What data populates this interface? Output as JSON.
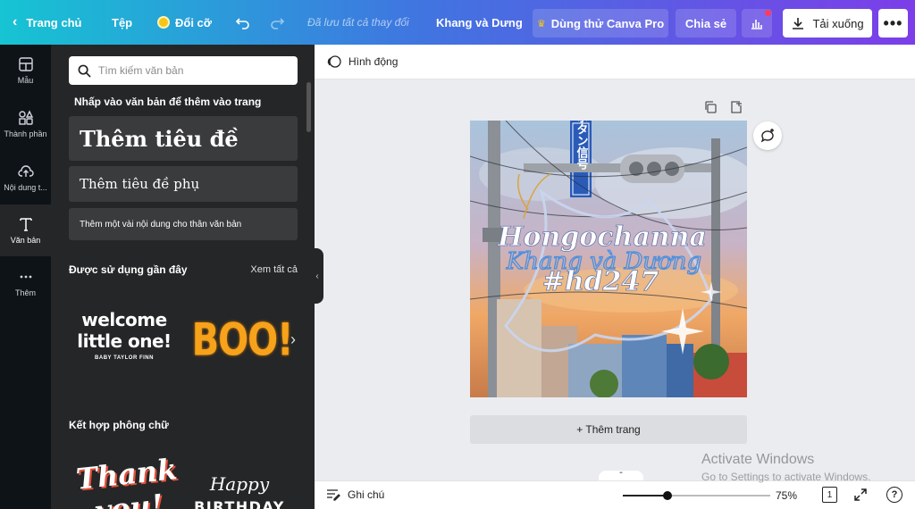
{
  "topbar": {
    "home": "Trang chủ",
    "file": "Tệp",
    "resize": "Đổi cỡ",
    "saved_status": "Đã lưu tất cả thay đổi",
    "design_name": "Khang và Dưng",
    "try_pro": "Dùng thử Canva Pro",
    "share": "Chia sẻ",
    "download": "Tải xuống"
  },
  "rail": {
    "items": [
      {
        "label": "Mẫu",
        "icon": "template-icon"
      },
      {
        "label": "Thành phần",
        "icon": "elements-icon"
      },
      {
        "label": "Nội dung t...",
        "icon": "upload-icon"
      },
      {
        "label": "Văn bản",
        "icon": "text-icon"
      },
      {
        "label": "Thêm",
        "icon": "more-icon"
      }
    ]
  },
  "panel": {
    "search_placeholder": "Tìm kiếm văn bản",
    "hint": "Nhấp vào văn bản để thêm vào trang",
    "add_heading": "Thêm tiêu đề",
    "add_subheading": "Thêm tiêu đề phụ",
    "add_body": "Thêm một vài nội dung cho thân văn bản",
    "recent_title": "Được sử dụng gần đây",
    "see_all": "Xem tất cả",
    "recent_items": [
      {
        "line1": "welcome",
        "line2": "little one!",
        "line3": "BABY TAYLOR FINN"
      },
      {
        "line1": "BOO!"
      }
    ],
    "combos_title": "Kết hợp phông chữ",
    "combo_items": [
      {
        "line1": "Thank",
        "line2": "you!"
      },
      {
        "line1": "Happy",
        "line2": "BIRTHDAY"
      }
    ]
  },
  "subbar": {
    "animate": "Hình động"
  },
  "design": {
    "line1": "Hongochanna",
    "line2": "Khang và Dương",
    "line3": "#hd247",
    "sign_text": "押ボタン信号"
  },
  "canvas": {
    "add_page": "+ Thêm trang"
  },
  "bottombar": {
    "notes": "Ghi chú",
    "zoom": "75%",
    "page_count": "1",
    "help": "?",
    "zoom_level": 0.3
  },
  "watermark": {
    "line1": "Activate Windows",
    "line2": "Go to Settings to activate Windows."
  },
  "colors": {
    "accent": "#7c3ee8",
    "boo_orange": "#f7a21b"
  }
}
